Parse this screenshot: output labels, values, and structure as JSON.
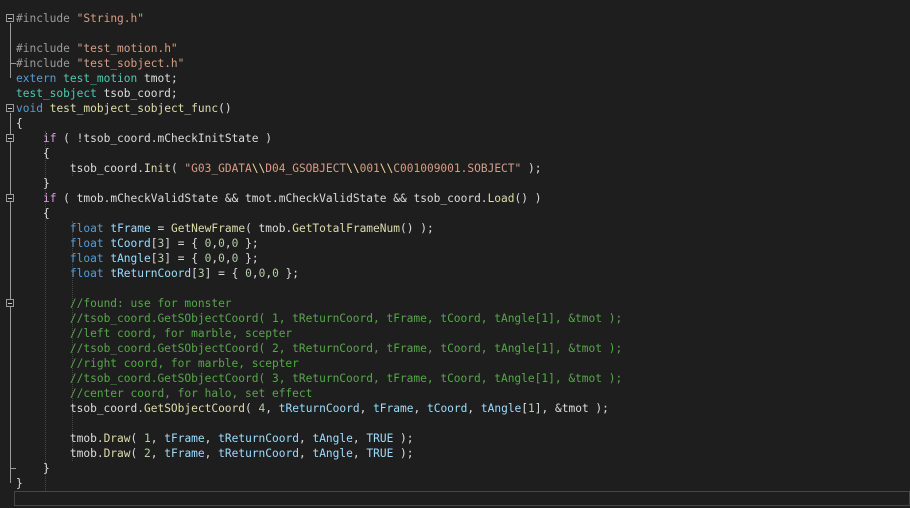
{
  "editor": {
    "lines": [
      {
        "fold": "open",
        "tokens": [
          {
            "t": "#include",
            "c": "pp"
          },
          {
            "t": " "
          },
          {
            "t": "\"String.h\"",
            "c": "str"
          }
        ]
      },
      {
        "tokens": []
      },
      {
        "tokens": [
          {
            "t": "#include",
            "c": "pp"
          },
          {
            "t": " "
          },
          {
            "t": "\"test_motion.h\"",
            "c": "str"
          }
        ]
      },
      {
        "tokens": [
          {
            "t": "#include",
            "c": "pp"
          },
          {
            "t": " "
          },
          {
            "t": "\"test_sobject.h\"",
            "c": "str"
          }
        ]
      },
      {
        "tokens": [
          {
            "t": "extern",
            "c": "kw"
          },
          {
            "t": " "
          },
          {
            "t": "test_motion",
            "c": "type"
          },
          {
            "t": " tmot;"
          }
        ]
      },
      {
        "tokens": [
          {
            "t": "test_sobject",
            "c": "type"
          },
          {
            "t": " tsob_coord;"
          }
        ]
      },
      {
        "fold": "open",
        "tokens": [
          {
            "t": "void",
            "c": "kw"
          },
          {
            "t": " "
          },
          {
            "t": "test_mobject_sobject_func",
            "c": "fn"
          },
          {
            "t": "()"
          }
        ]
      },
      {
        "tokens": [
          {
            "t": "{"
          }
        ]
      },
      {
        "fold": "open",
        "tokens": [
          {
            "t": "    "
          },
          {
            "t": "if",
            "c": "ctrl"
          },
          {
            "t": " ( !tsob_coord."
          },
          {
            "t": "mCheckInitState",
            "c": "mem"
          },
          {
            "t": " )"
          }
        ]
      },
      {
        "tokens": [
          {
            "t": "    {"
          }
        ]
      },
      {
        "tokens": [
          {
            "t": "        tsob_coord."
          },
          {
            "t": "Init",
            "c": "fn"
          },
          {
            "t": "( "
          },
          {
            "t": "\"G03_GDATA",
            "c": "str"
          },
          {
            "t": "\\\\",
            "c": "esc"
          },
          {
            "t": "D04_GSOBJECT",
            "c": "str"
          },
          {
            "t": "\\\\",
            "c": "esc"
          },
          {
            "t": "001",
            "c": "str"
          },
          {
            "t": "\\\\",
            "c": "esc"
          },
          {
            "t": "C001009001.SOBJECT\"",
            "c": "str"
          },
          {
            "t": " );"
          }
        ]
      },
      {
        "tokens": [
          {
            "t": "    }"
          }
        ]
      },
      {
        "fold": "open",
        "tokens": [
          {
            "t": "    "
          },
          {
            "t": "if",
            "c": "ctrl"
          },
          {
            "t": " ( tmob."
          },
          {
            "t": "mCheckValidState",
            "c": "mem"
          },
          {
            "t": " && tmot."
          },
          {
            "t": "mCheckValidState",
            "c": "mem"
          },
          {
            "t": " && tsob_coord."
          },
          {
            "t": "Load",
            "c": "fn"
          },
          {
            "t": "() )"
          }
        ]
      },
      {
        "tokens": [
          {
            "t": "    {"
          }
        ]
      },
      {
        "tokens": [
          {
            "t": "        "
          },
          {
            "t": "float",
            "c": "kw"
          },
          {
            "t": " "
          },
          {
            "t": "tFrame",
            "c": "var"
          },
          {
            "t": " = "
          },
          {
            "t": "GetNewFrame",
            "c": "fn"
          },
          {
            "t": "( tmob."
          },
          {
            "t": "GetTotalFrameNum",
            "c": "fn"
          },
          {
            "t": "() );"
          }
        ]
      },
      {
        "tokens": [
          {
            "t": "        "
          },
          {
            "t": "float",
            "c": "kw"
          },
          {
            "t": " "
          },
          {
            "t": "tCoord",
            "c": "var"
          },
          {
            "t": "["
          },
          {
            "t": "3",
            "c": "num"
          },
          {
            "t": "] = { "
          },
          {
            "t": "0",
            "c": "num"
          },
          {
            "t": ","
          },
          {
            "t": "0",
            "c": "num"
          },
          {
            "t": ","
          },
          {
            "t": "0",
            "c": "num"
          },
          {
            "t": " };"
          }
        ]
      },
      {
        "tokens": [
          {
            "t": "        "
          },
          {
            "t": "float",
            "c": "kw"
          },
          {
            "t": " "
          },
          {
            "t": "tAngle",
            "c": "var"
          },
          {
            "t": "["
          },
          {
            "t": "3",
            "c": "num"
          },
          {
            "t": "] = { "
          },
          {
            "t": "0",
            "c": "num"
          },
          {
            "t": ","
          },
          {
            "t": "0",
            "c": "num"
          },
          {
            "t": ","
          },
          {
            "t": "0",
            "c": "num"
          },
          {
            "t": " };"
          }
        ]
      },
      {
        "tokens": [
          {
            "t": "        "
          },
          {
            "t": "float",
            "c": "kw"
          },
          {
            "t": " "
          },
          {
            "t": "tReturnCoord",
            "c": "var"
          },
          {
            "t": "["
          },
          {
            "t": "3",
            "c": "num"
          },
          {
            "t": "] = { "
          },
          {
            "t": "0",
            "c": "num"
          },
          {
            "t": ","
          },
          {
            "t": "0",
            "c": "num"
          },
          {
            "t": ","
          },
          {
            "t": "0",
            "c": "num"
          },
          {
            "t": " };"
          }
        ]
      },
      {
        "tokens": []
      },
      {
        "fold": "open",
        "tokens": [
          {
            "t": "        "
          },
          {
            "t": "//found: use for monster",
            "c": "cm"
          }
        ]
      },
      {
        "tokens": [
          {
            "t": "        "
          },
          {
            "t": "//tsob_coord.GetSObjectCoord( 1, tReturnCoord, tFrame, tCoord, tAngle[1], &tmot );",
            "c": "cm"
          }
        ]
      },
      {
        "tokens": [
          {
            "t": "        "
          },
          {
            "t": "//left coord, for marble, scepter",
            "c": "cm"
          }
        ]
      },
      {
        "tokens": [
          {
            "t": "        "
          },
          {
            "t": "//tsob_coord.GetSObjectCoord( 2, tReturnCoord, tFrame, tCoord, tAngle[1], &tmot );",
            "c": "cm"
          }
        ]
      },
      {
        "tokens": [
          {
            "t": "        "
          },
          {
            "t": "//right coord, for marble, scepter",
            "c": "cm"
          }
        ]
      },
      {
        "tokens": [
          {
            "t": "        "
          },
          {
            "t": "//tsob_coord.GetSObjectCoord( 3, tReturnCoord, tFrame, tCoord, tAngle[1], &tmot );",
            "c": "cm"
          }
        ]
      },
      {
        "tokens": [
          {
            "t": "        "
          },
          {
            "t": "//center coord, for halo, set effect",
            "c": "cm"
          }
        ]
      },
      {
        "tokens": [
          {
            "t": "        tsob_coord."
          },
          {
            "t": "GetSObjectCoord",
            "c": "fn"
          },
          {
            "t": "( "
          },
          {
            "t": "4",
            "c": "num"
          },
          {
            "t": ", "
          },
          {
            "t": "tReturnCoord",
            "c": "var"
          },
          {
            "t": ", "
          },
          {
            "t": "tFrame",
            "c": "var"
          },
          {
            "t": ", "
          },
          {
            "t": "tCoord",
            "c": "var"
          },
          {
            "t": ", "
          },
          {
            "t": "tAngle",
            "c": "var"
          },
          {
            "t": "["
          },
          {
            "t": "1",
            "c": "num"
          },
          {
            "t": "], &tmot );"
          }
        ]
      },
      {
        "tokens": []
      },
      {
        "tokens": [
          {
            "t": "        tmob."
          },
          {
            "t": "Draw",
            "c": "fn"
          },
          {
            "t": "( "
          },
          {
            "t": "1",
            "c": "num"
          },
          {
            "t": ", "
          },
          {
            "t": "tFrame",
            "c": "var"
          },
          {
            "t": ", "
          },
          {
            "t": "tReturnCoord",
            "c": "var"
          },
          {
            "t": ", "
          },
          {
            "t": "tAngle",
            "c": "var"
          },
          {
            "t": ", "
          },
          {
            "t": "TRUE",
            "c": "var"
          },
          {
            "t": " );"
          }
        ]
      },
      {
        "tokens": [
          {
            "t": "        tmob."
          },
          {
            "t": "Draw",
            "c": "fn"
          },
          {
            "t": "( "
          },
          {
            "t": "2",
            "c": "num"
          },
          {
            "t": ", "
          },
          {
            "t": "tFrame",
            "c": "var"
          },
          {
            "t": ", "
          },
          {
            "t": "tReturnCoord",
            "c": "var"
          },
          {
            "t": ", "
          },
          {
            "t": "tAngle",
            "c": "var"
          },
          {
            "t": ", "
          },
          {
            "t": "TRUE",
            "c": "var"
          },
          {
            "t": " );"
          }
        ]
      },
      {
        "tokens": [
          {
            "t": "    }"
          }
        ]
      },
      {
        "tokens": [
          {
            "t": "}"
          }
        ]
      },
      {
        "tokens": []
      }
    ]
  }
}
